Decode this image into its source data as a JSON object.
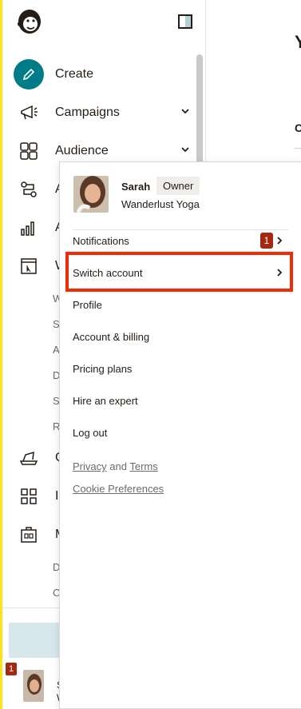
{
  "sidebar": {
    "items": [
      {
        "label": "Create",
        "icon": "pencil-icon"
      },
      {
        "label": "Campaigns",
        "icon": "megaphone-icon"
      },
      {
        "label": "Audience",
        "icon": "audience-icon"
      },
      {
        "label": "A",
        "icon": "automation-icon"
      },
      {
        "label": "A",
        "icon": "analytics-icon"
      },
      {
        "label": "W",
        "icon": "website-icon"
      },
      {
        "label": "C",
        "icon": "content-icon"
      },
      {
        "label": "In",
        "icon": "integrations-icon"
      },
      {
        "label": "M",
        "icon": "manage-icon"
      }
    ],
    "sub_letters_1": [
      "W",
      "S",
      "A",
      "D",
      "S",
      "R"
    ],
    "sub_letters_2": [
      "D",
      "C"
    ],
    "footer": {
      "badge": "1",
      "letter_s": "S",
      "letter_w": "W"
    }
  },
  "profile_menu": {
    "name": "Sarah",
    "role": "Owner",
    "org": "Wanderlust Yoga",
    "items": [
      {
        "label": "Notifications",
        "badge": "1"
      },
      {
        "label": "Switch account"
      },
      {
        "label": "Profile"
      },
      {
        "label": "Account & billing"
      },
      {
        "label": "Pricing plans"
      },
      {
        "label": "Hire an expert"
      },
      {
        "label": "Log out"
      }
    ],
    "legal": {
      "privacy": "Privacy",
      "and": "and",
      "terms": "Terms",
      "cookie": "Cookie Preferences"
    }
  },
  "main": {
    "heading_letter": "Y",
    "sub_letter": "C"
  },
  "colors": {
    "accent": "#007c89",
    "highlight": "#f42a06",
    "badge": "#a32a11",
    "edge": "#ffe01b"
  }
}
